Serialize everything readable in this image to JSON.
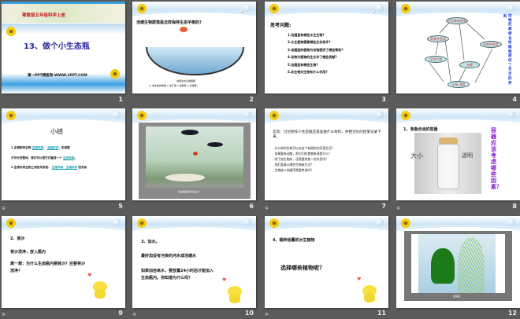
{
  "slides": [
    {
      "number": "1",
      "publisher": "鄂教版五年级科学上册",
      "title": "13、做个小生态瓶",
      "website": "第一PPT模板网-WWW.1PPT.COM"
    },
    {
      "number": "2",
      "title": "池塘生物群落是怎样保持生态平衡的?",
      "caption": "池塘生态系统图解",
      "legend": "(1 非生物的物质 2 生产者 3 消费者 4 分解者)"
    },
    {
      "number": "3",
      "heading": "思考问题:",
      "questions": [
        "1.池塘里有哪些水生生物?",
        "2.水生植物需要哪些生存条件?",
        "3.池塘里的植物为动物提供了哪些帮助?",
        "4.动物为植物的生长作了哪些贡献?",
        "5.池塘里有哪些生物?",
        "6.非生物对生物有什么作用?"
      ]
    },
    {
      "number": "4",
      "nodes": [
        "大型食肉鱼类",
        "肉食性鱼类",
        "杂食性鱼类",
        "浮游生物",
        "虫螺",
        "水草 藻类"
      ],
      "side_text": "动物的粪便也给植物提供了充足的养",
      "side_text_end": "料"
    },
    {
      "number": "5",
      "title": "小结",
      "line1a": "1.生物和非生物",
      "blank1": "互相作用",
      "sep": "、",
      "blank2": "互相依存",
      "line1b": "，形成密",
      "line2a": "不可分的整体，我们可以把它们看成一个",
      "blank3": "生态系统",
      "line2b": "。",
      "line3a": "2.生物与非生物之间的关系是：",
      "blank4": "互相作用、互相依存",
      "line3b": "的关系"
    },
    {
      "number": "6",
      "caption": "生态瓶里的环境设计"
    },
    {
      "number": "7",
      "heading": "实验：讨论制作小生态瓶应该准备什么材料，并把讨论的结果记录下来。",
      "bullets": [
        "什么样的生物可以在这个有限的空间里生活？",
        "如果要有动物，那它们的食物来源是什么？",
        "除了加生物外，还需要其他一些东西吗？",
        "你们准备以哪些生物来生活？",
        "生物放入的顺序需要考虑吗？"
      ]
    },
    {
      "number": "8",
      "heading": "1、准备合适的容器",
      "label_size": "大小",
      "label_clear": "透明",
      "side_text": "容器应该考虑哪些因素？"
    },
    {
      "number": "9",
      "heading": "2、装沙",
      "line1": "将沙洗净，放入瓶内",
      "line2": "想一想：为什么生态瓶内要装沙？还要将沙",
      "line3": "洗净？"
    },
    {
      "number": "10",
      "heading": "3、加水。",
      "line1": "最好加没有污染的河水或池塘水",
      "line2": "如果加自来水，要放置24小时后才能加入",
      "line3": "生态瓶内。你知道为什么吗？"
    },
    {
      "number": "11",
      "heading": "4、栽种适量的水生植物",
      "question": "选择哪些植物呢？"
    },
    {
      "number": "12",
      "caption": "金鱼藻"
    }
  ],
  "colors": {
    "background": "#5b5b5b",
    "title_blue": "#2a2a9a",
    "accent_red": "#d33",
    "side_purple": "#8a1ad0"
  }
}
